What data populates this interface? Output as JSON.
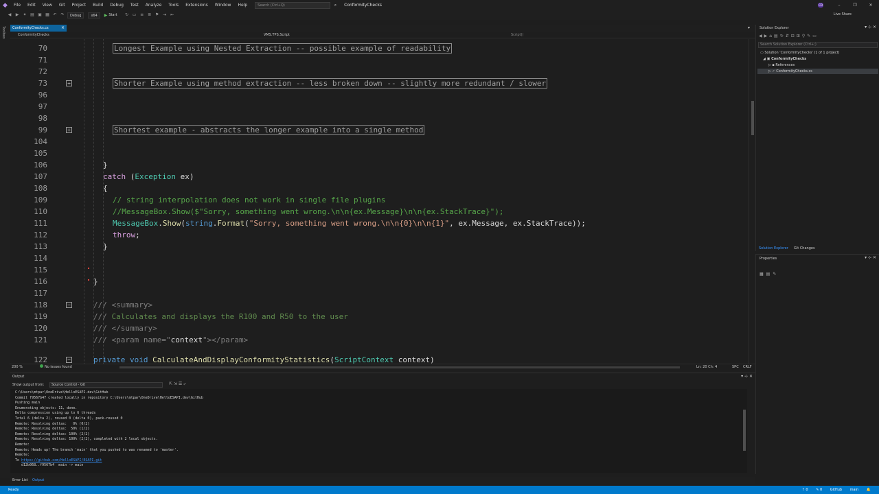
{
  "menu": {
    "items": [
      "File",
      "Edit",
      "View",
      "Git",
      "Project",
      "Build",
      "Debug",
      "Test",
      "Analyze",
      "Tools",
      "Extensions",
      "Window",
      "Help"
    ],
    "search_placeholder": "Search (Ctrl+Q)",
    "solution_name": "ConformityChecks",
    "avatar_initials": "CD"
  },
  "toolbar": {
    "config": "Debug",
    "platform": "x64",
    "start_label": "Start",
    "live_share": "Live Share"
  },
  "toolbox_label": "Toolbox",
  "document_tab": {
    "label": "ConformityChecks.cs",
    "pin": "⊹",
    "close": "×"
  },
  "navbar": {
    "project": "ConformityChecks",
    "class": "VMS.TPS.Script",
    "member": "Script()"
  },
  "editor": {
    "lines": [
      {
        "n": "70",
        "segments": [
          {
            "c": "collapsed-box",
            "t": "Longest Example using Nested Extraction -- possible example of readability"
          }
        ],
        "indent": 150
      },
      {
        "n": "71",
        "segments": [],
        "indent": 150
      },
      {
        "n": "72",
        "segments": [],
        "indent": 150
      },
      {
        "n": "73",
        "segments": [
          {
            "c": "collapsed-box",
            "t": "Shorter Example using method extraction -- less broken down -- slightly more redundant / slower"
          }
        ],
        "indent": 150,
        "fold": "+"
      },
      {
        "n": "96",
        "segments": [],
        "indent": 150
      },
      {
        "n": "97",
        "segments": [],
        "indent": 150
      },
      {
        "n": "98",
        "segments": [],
        "indent": 150
      },
      {
        "n": "99",
        "segments": [
          {
            "c": "collapsed-box",
            "t": "Shortest example - abstracts the longer example into a single method"
          }
        ],
        "indent": 150,
        "fold": "+"
      },
      {
        "n": "104",
        "segments": [],
        "indent": 150
      },
      {
        "n": "105",
        "segments": [],
        "indent": 150
      },
      {
        "n": "106",
        "segments": [
          {
            "c": "id",
            "t": "}"
          }
        ],
        "indent": 136
      },
      {
        "n": "107",
        "segments": [
          {
            "c": "ctl",
            "t": "catch"
          },
          {
            "c": "id",
            "t": " ("
          },
          {
            "c": "typ",
            "t": "Exception"
          },
          {
            "c": "id",
            "t": " ex)"
          }
        ],
        "indent": 136
      },
      {
        "n": "108",
        "segments": [
          {
            "c": "id",
            "t": "{"
          }
        ],
        "indent": 136
      },
      {
        "n": "109",
        "segments": [
          {
            "c": "cmt",
            "t": "// string interpolation does not work in single file plugins"
          }
        ],
        "indent": 150
      },
      {
        "n": "110",
        "segments": [
          {
            "c": "cmt",
            "t": "//MessageBox.Show($\"Sorry, something went wrong.\\n\\n{ex.Message}\\n\\n{ex.StackTrace}\");"
          }
        ],
        "indent": 150
      },
      {
        "n": "111",
        "segments": [
          {
            "c": "typ",
            "t": "MessageBox"
          },
          {
            "c": "id",
            "t": "."
          },
          {
            "c": "mth",
            "t": "Show"
          },
          {
            "c": "id",
            "t": "("
          },
          {
            "c": "kw",
            "t": "string"
          },
          {
            "c": "id",
            "t": "."
          },
          {
            "c": "mth",
            "t": "Format"
          },
          {
            "c": "id",
            "t": "("
          },
          {
            "c": "str",
            "t": "\"Sorry, something went wrong.\\n\\n{0}\\n\\n{1}\""
          },
          {
            "c": "id",
            "t": ", ex.Message, ex.StackTrace));"
          }
        ],
        "indent": 150
      },
      {
        "n": "112",
        "segments": [
          {
            "c": "ctl",
            "t": "throw"
          },
          {
            "c": "id",
            "t": ";"
          }
        ],
        "indent": 150
      },
      {
        "n": "113",
        "segments": [
          {
            "c": "id",
            "t": "}"
          }
        ],
        "indent": 136
      },
      {
        "n": "114",
        "segments": [],
        "indent": 136
      },
      {
        "n": "115",
        "segments": [],
        "indent": 136
      },
      {
        "n": "116",
        "segments": [
          {
            "c": "id",
            "t": "}"
          }
        ],
        "indent": 122
      },
      {
        "n": "117",
        "segments": [],
        "indent": 122
      },
      {
        "n": "118",
        "segments": [
          {
            "c": "docg",
            "t": "/// "
          },
          {
            "c": "docg",
            "t": "<summary>"
          }
        ],
        "indent": 122,
        "fold": "−"
      },
      {
        "n": "119",
        "segments": [
          {
            "c": "docg",
            "t": "/// "
          },
          {
            "c": "doc",
            "t": "Calculates and displays the R100 and R50 to the user"
          }
        ],
        "indent": 122
      },
      {
        "n": "120",
        "segments": [
          {
            "c": "docg",
            "t": "/// "
          },
          {
            "c": "docg",
            "t": "</summary>"
          }
        ],
        "indent": 122
      },
      {
        "n": "121",
        "segments": [
          {
            "c": "docg",
            "t": "/// "
          },
          {
            "c": "docg",
            "t": "<param "
          },
          {
            "c": "docg",
            "t": "name"
          },
          {
            "c": "docg",
            "t": "=\""
          },
          {
            "c": "id",
            "t": "context"
          },
          {
            "c": "docg",
            "t": "\"></param>"
          }
        ],
        "indent": 122
      },
      {
        "n": "122",
        "segments": [
          {
            "c": "kw",
            "t": "private"
          },
          {
            "c": "id",
            "t": " "
          },
          {
            "c": "kw",
            "t": "void"
          },
          {
            "c": "id",
            "t": " "
          },
          {
            "c": "mth",
            "t": "CalculateAndDisplayConformityStatistics"
          },
          {
            "c": "id",
            "t": "("
          },
          {
            "c": "typ",
            "t": "ScriptContext"
          },
          {
            "c": "id",
            "t": " context)"
          }
        ],
        "indent": 122,
        "fold": "−"
      }
    ]
  },
  "editor_status": {
    "zoom": "200 %",
    "issues": "No issues found",
    "line_col": "Ln: 20   Ch: 4",
    "spc": "SPC",
    "crlf": "CRLF"
  },
  "output": {
    "title": "Output",
    "source_label": "Show output from:",
    "source_value": "Source Control - Git",
    "lines": [
      "C:\\Users\\mtpar\\OneDrive\\HelloESAPI.dev\\GitHub",
      "Commit f9567b47 created locally in repository C:\\Users\\mtpar\\OneDrive\\HelloESAPI.dev\\GitHub",
      "Pushing main",
      "Enumerating objects: 11, done.",
      "Delta compression using up to 6 threads",
      "Total 6 (delta 2), reused 0 (delta 0), pack-reused 0",
      "Remote: Resolving deltas:   0% (0/2)",
      "Remote: Resolving deltas:  50% (1/2)",
      "Remote: Resolving deltas: 100% (2/2)",
      "Remote: Resolving deltas: 100% (2/2), completed with 2 local objects.",
      "Remote:",
      "Remote: Heads up! The branch 'main' that you pushed to was renamed to 'master'.",
      "Remote:"
    ],
    "link_prefix": "To ",
    "link": "https://github.com/HelloESAPI/ESAPI.git",
    "last_line": "   d12b068..f9567b4  main -> main"
  },
  "bottom_tabs": {
    "error_list": "Error List",
    "output": "Output"
  },
  "solution_explorer": {
    "title": "Solution Explorer",
    "search_placeholder": "Search Solution Explorer (Ctrl+;)",
    "tree": [
      "Solution 'ConformityChecks' (1 of 1 project)",
      "ConformityChecks",
      "References",
      "ConformityChecks.cs"
    ],
    "tab_se": "Solution Explorer",
    "tab_git": "Git Changes"
  },
  "properties": {
    "title": "Properties"
  },
  "statusbar": {
    "ready": "Ready",
    "up": "↑ 0",
    "pencil": "✎ 0",
    "repo": "GitHub",
    "branch": "main"
  },
  "colors": {
    "accent": "#007acc",
    "tab_active": "#0e639c",
    "editor_bg": "#1e1e1e"
  }
}
